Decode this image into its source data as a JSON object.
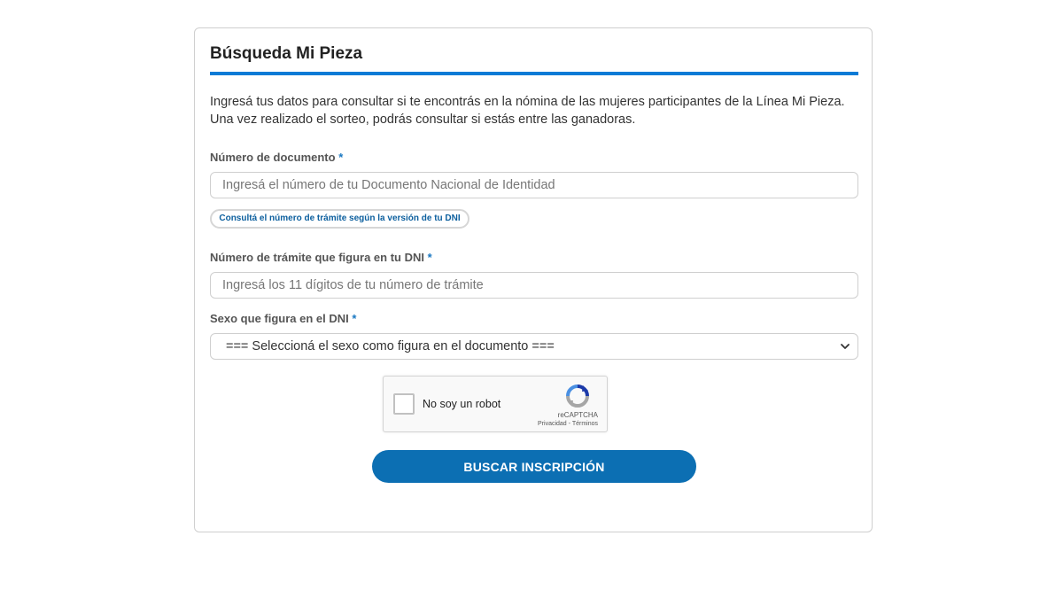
{
  "form": {
    "title": "Búsqueda Mi Pieza",
    "intro": "Ingresá tus datos para consultar si te encontrás en la nómina de las mujeres participantes de la Línea Mi Pieza. Una vez realizado el sorteo, podrás consultar si estás entre las ganadoras.",
    "accent_color": "#0a7bd6",
    "document_field": {
      "label": "Número de documento",
      "required_mark": "*",
      "placeholder": "Ingresá el número de tu Documento Nacional de Identidad",
      "value": ""
    },
    "tramite_help_link": "Consultá el número de trámite según la versión de tu DNI",
    "tramite_field": {
      "label": "Número de trámite que figura en tu DNI",
      "required_mark": "*",
      "placeholder": "Ingresá los 11 dígitos de tu número de trámite",
      "value": ""
    },
    "sex_field": {
      "label": "Sexo que figura en el DNI",
      "required_mark": "*",
      "selected": "=== Seleccioná el sexo como figura en el documento ===",
      "icon": "chevron-down-icon"
    },
    "recaptcha": {
      "label": "No soy un robot",
      "brand": "reCAPTCHA",
      "privacy": "Privacidad",
      "separator": " - ",
      "terms": "Términos",
      "checked": false,
      "icon": "recaptcha-logo-icon"
    },
    "submit_label": "BUSCAR INSCRIPCIÓN",
    "button_color": "#0c6fb3"
  }
}
